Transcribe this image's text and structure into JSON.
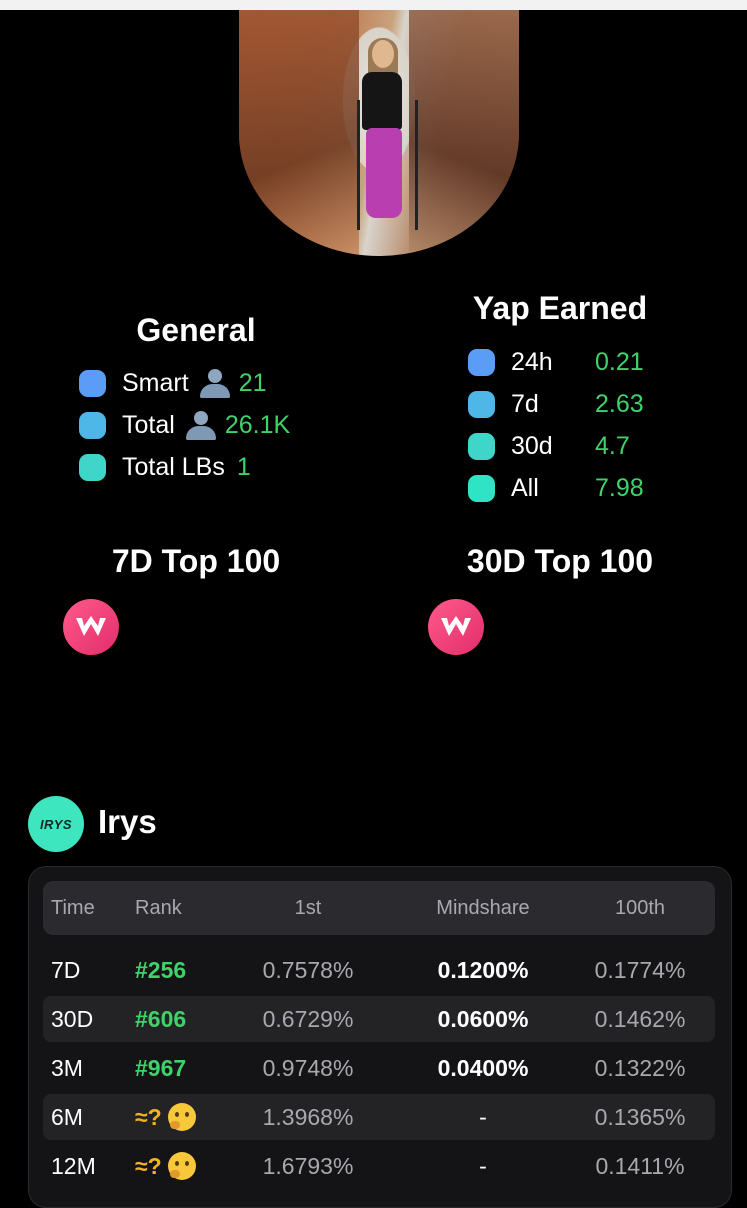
{
  "profile": {
    "avatar_icon": "profile-photo"
  },
  "general": {
    "title": "General",
    "items": [
      {
        "label": "Smart",
        "icon": "person-icon",
        "value": "21",
        "color": "#5b9cf6"
      },
      {
        "label": "Total",
        "icon": "person-icon",
        "value": "26.1K",
        "color": "#4fb6e8"
      },
      {
        "label": "Total LBs",
        "value": "1",
        "color": "#3fd6c9"
      }
    ]
  },
  "yap_earned": {
    "title": "Yap Earned",
    "items": [
      {
        "label": "24h",
        "value": "0.21",
        "color": "#5b9cf6"
      },
      {
        "label": "7d",
        "value": "2.63",
        "color": "#4fb6e8"
      },
      {
        "label": "30d",
        "value": "4.7",
        "color": "#3fd6c9"
      },
      {
        "label": "All",
        "value": "7.98",
        "color": "#2fe3c5"
      }
    ]
  },
  "top100": {
    "seven_day_title": "7D Top 100",
    "thirty_day_title": "30D Top 100",
    "icon": "w-brand-icon"
  },
  "irys": {
    "logo_text": "IRYS",
    "title": "Irys",
    "columns": [
      "Time",
      "Rank",
      "1st",
      "Mindshare",
      "100th"
    ],
    "rows": [
      {
        "time": "7D",
        "rank": "#256",
        "first": "0.7578%",
        "mindshare": "0.1200%",
        "hundredth": "0.1774%"
      },
      {
        "time": "30D",
        "rank": "#606",
        "first": "0.6729%",
        "mindshare": "0.0600%",
        "hundredth": "0.1462%"
      },
      {
        "time": "3M",
        "rank": "#967",
        "first": "0.9748%",
        "mindshare": "0.0400%",
        "hundredth": "0.1322%"
      },
      {
        "time": "6M",
        "rank": "≈?",
        "first": "1.3968%",
        "mindshare": "-",
        "hundredth": "0.1365%"
      },
      {
        "time": "12M",
        "rank": "≈?",
        "first": "1.6793%",
        "mindshare": "-",
        "hundredth": "0.1411%"
      }
    ]
  },
  "colors": {
    "positive": "#3fd26a",
    "unknown_rank": "#f0b323",
    "irys_brand": "#3ee6c0",
    "w_brand": "#e22d6b"
  }
}
